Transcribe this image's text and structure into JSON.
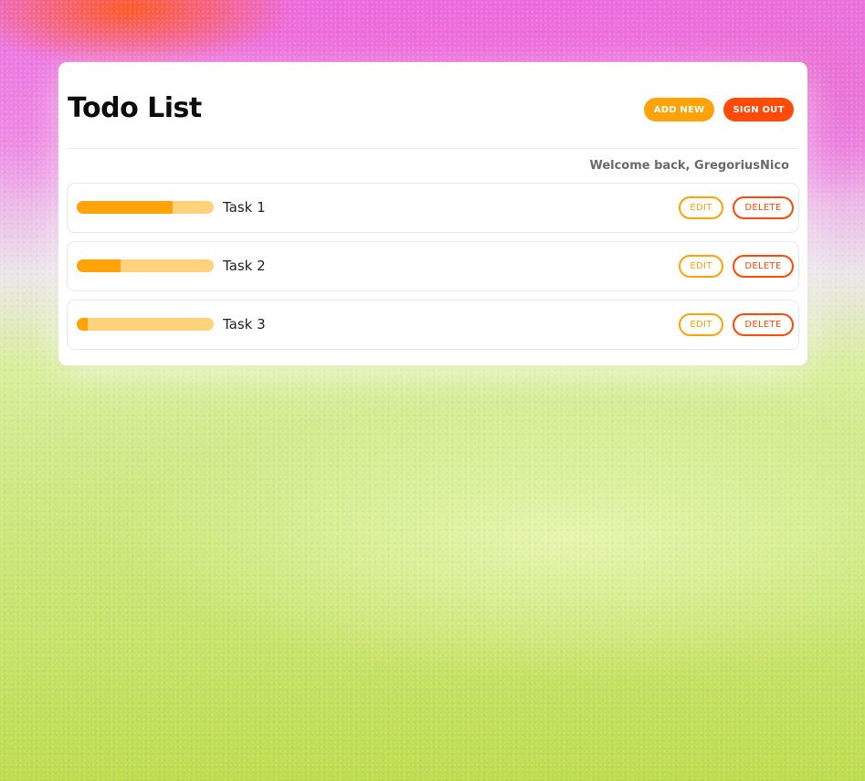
{
  "colors": {
    "accent_orange": "#ffa309",
    "accent_red": "#ff4b07",
    "progress_track": "#ffd27b"
  },
  "header": {
    "title": "Todo List",
    "add_new_label": "ADD NEW",
    "sign_out_label": "SIGN OUT"
  },
  "welcome_text": "Welcome back, GregoriusNico",
  "tasks": [
    {
      "name": "Task 1",
      "progress": 0.7,
      "edit_label": "EDIT",
      "delete_label": "DELETE"
    },
    {
      "name": "Task 2",
      "progress": 0.32,
      "edit_label": "EDIT",
      "delete_label": "DELETE"
    },
    {
      "name": "Task 3",
      "progress": 0.08,
      "edit_label": "EDIT",
      "delete_label": "DELETE"
    }
  ]
}
